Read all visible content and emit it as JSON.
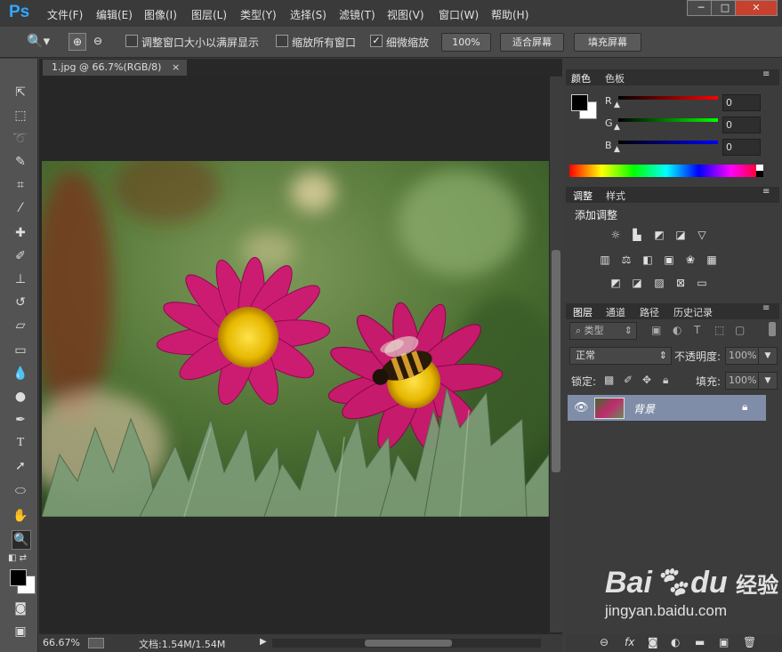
{
  "app": {
    "logo": "Ps"
  },
  "menu": [
    "文件(F)",
    "编辑(E)",
    "图像(I)",
    "图层(L)",
    "类型(Y)",
    "选择(S)",
    "滤镜(T)",
    "视图(V)",
    "窗口(W)",
    "帮助(H)"
  ],
  "window_controls": {
    "minimize": "─",
    "maximize": "□",
    "close": "✕"
  },
  "options_bar": {
    "resize_windows_label": "调整窗口大小以满屏显示",
    "resize_windows_checked": false,
    "zoom_all_label": "缩放所有窗口",
    "zoom_all_checked": false,
    "scrubby_zoom_label": "细微缩放",
    "scrubby_zoom_checked": true,
    "btn_100": "100%",
    "btn_fit": "适合屏幕",
    "btn_fill": "填充屏幕"
  },
  "document": {
    "tab_title": "1.jpg @ 66.7%(RGB/8)",
    "tab_close": "×",
    "zoom": "66.67%",
    "doc_info": "文档:1.54M/1.54M"
  },
  "color_panel": {
    "tabs": [
      "颜色",
      "色板"
    ],
    "channels": [
      {
        "label": "R",
        "value": "0",
        "color": "#d42020"
      },
      {
        "label": "G",
        "value": "0",
        "color": "#20c020"
      },
      {
        "label": "B",
        "value": "0",
        "color": "#2020d8"
      }
    ]
  },
  "adjust_panel": {
    "tabs": [
      "调整",
      "样式"
    ],
    "title": "添加调整",
    "icons_row1": [
      "brightness-icon",
      "levels-icon",
      "curves-icon",
      "exposure-icon",
      "vibrance-icon"
    ],
    "icons_row2": [
      "hue-saturation-icon",
      "color-balance-icon",
      "black-white-icon",
      "photo-filter-icon",
      "channel-mixer-icon",
      "color-lookup-icon"
    ],
    "icons_row3": [
      "invert-icon",
      "posterize-icon",
      "threshold-icon",
      "selective-color-icon",
      "gradient-map-icon"
    ]
  },
  "layers_panel": {
    "tabs": [
      "图层",
      "通道",
      "路径",
      "历史记录"
    ],
    "filter_label": "类型",
    "blend_mode": "正常",
    "opacity_label": "不透明度:",
    "opacity_value": "100%",
    "lock_label": "锁定:",
    "fill_label": "填充:",
    "fill_value": "100%",
    "layers": [
      {
        "name": "背景",
        "visible": true,
        "locked": true
      }
    ]
  },
  "watermark": {
    "brand": "Bai",
    "brand2": "du",
    "suffix": "经验",
    "url": "jingyan.baidu.com"
  },
  "colors": {
    "accent": "#31a8ff",
    "layer_selected": "#7f8da8",
    "panel_bg": "#3c3c3c",
    "toolbox_bg": "#535353"
  }
}
